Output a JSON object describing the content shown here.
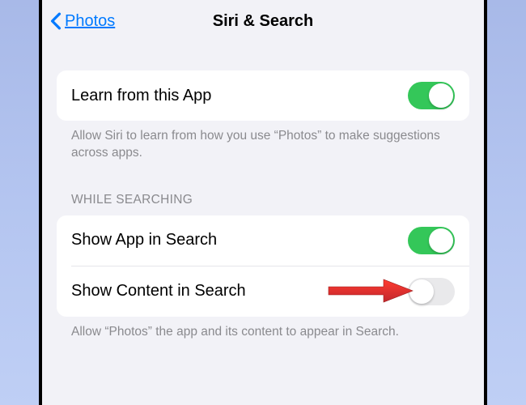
{
  "nav": {
    "back_label": "Photos",
    "title": "Siri & Search"
  },
  "section1": {
    "row1": {
      "label": "Learn from this App"
    },
    "footer": "Allow Siri to learn from how you use “Photos” to make suggestions across apps."
  },
  "section2": {
    "header": "WHILE SEARCHING",
    "row1": {
      "label": "Show App in Search"
    },
    "row2": {
      "label": "Show Content in Search"
    },
    "footer": "Allow “Photos” the app and its content to appear in Search."
  }
}
